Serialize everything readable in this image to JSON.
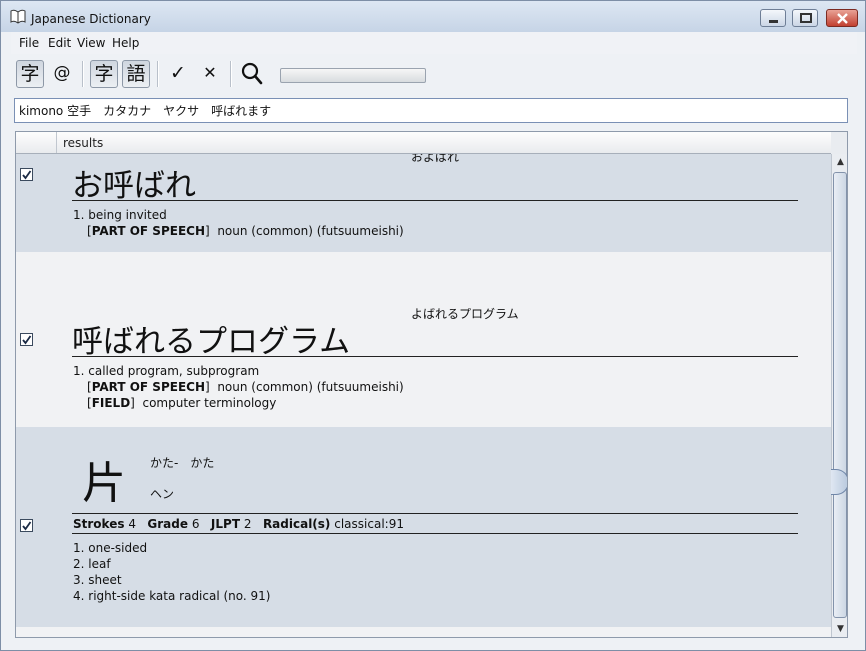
{
  "window": {
    "title": "Japanese Dictionary",
    "app_icon": "open-book-icon"
  },
  "menu": [
    "File",
    "Edit",
    "View",
    "Help"
  ],
  "toolbar": {
    "kanji_mode_glyph": "字",
    "email_glyph": "@",
    "char_glyph": "字",
    "word_glyph": "語",
    "check_glyph": "✓",
    "cross_glyph": "✕",
    "search_icon": "magnifier-icon",
    "progress": 0
  },
  "search": {
    "value": "kimono 空手　カタカナ　ヤクサ　呼ばれます"
  },
  "table": {
    "column_header": "results"
  },
  "results": [
    {
      "checked": true,
      "reading": "およばれ",
      "headword": "お呼ばれ",
      "senses": [
        {
          "text": "1. being invited",
          "tags": [
            {
              "label": "PART OF SPEECH",
              "value": "noun (common) (futsuumeishi)"
            }
          ]
        }
      ]
    },
    {
      "checked": true,
      "reading": "よばれるプログラム",
      "headword": "呼ばれるプログラム",
      "senses": [
        {
          "text": "1. called program, subprogram",
          "tags": [
            {
              "label": "PART OF SPEECH",
              "value": "noun (common) (futsuumeishi)"
            },
            {
              "label": "FIELD",
              "value": "computer terminology"
            }
          ]
        }
      ]
    },
    {
      "checked": true,
      "kanji": "片",
      "kun_readings": "かた-　かた",
      "on_readings": "ヘン",
      "info": {
        "strokes_label": "Strokes",
        "strokes": "4",
        "grade_label": "Grade",
        "grade": "6",
        "jlpt_label": "JLPT",
        "jlpt": "2",
        "radical_label": "Radical(s)",
        "radical": "classical:91"
      },
      "meanings": [
        "1. one-sided",
        "2. leaf",
        "3. sheet",
        "4. right-side kata radical (no. 91)"
      ]
    }
  ]
}
